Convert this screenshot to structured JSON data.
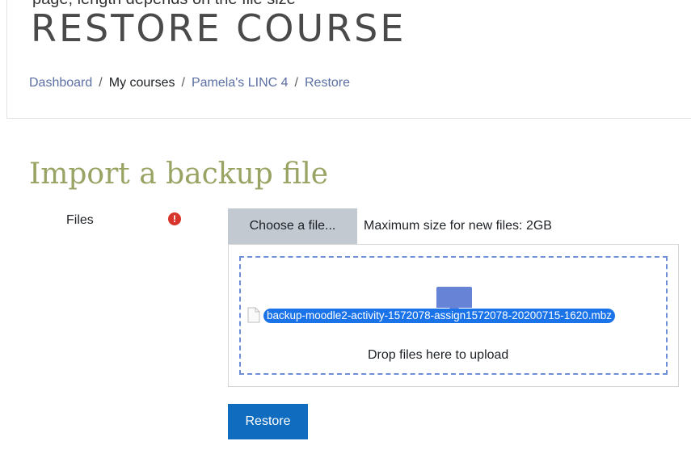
{
  "header": {
    "partial_top_text": "page, length depends on the file size",
    "title": "RESTORE COURSE",
    "breadcrumb": [
      {
        "label": "Dashboard",
        "link": true
      },
      {
        "label": "My courses",
        "link": false
      },
      {
        "label": "Pamela's LINC 4",
        "link": true
      },
      {
        "label": "Restore",
        "link": true
      }
    ],
    "breadcrumb_separator": "/"
  },
  "import": {
    "heading": "Import a backup file",
    "files_label": "Files",
    "required_icon": "exclamation-circle-icon",
    "required_symbol": "!",
    "choose_button": "Choose a file...",
    "max_size": "Maximum size for new files: 2GB",
    "dragged_file": "backup-moodle2-activity-1572078-assign1572078-20200715-1620.mbz",
    "drop_text": "Drop files here to upload",
    "restore_button": "Restore"
  },
  "colors": {
    "heading": "#98a464",
    "link": "#5b6fa3",
    "restore_button": "#0f6cbf",
    "choose_button": "#c3c9d1",
    "dashed_border": "#6e8fd8",
    "file_highlight": "#1a73e8",
    "required": "#d9342b"
  }
}
